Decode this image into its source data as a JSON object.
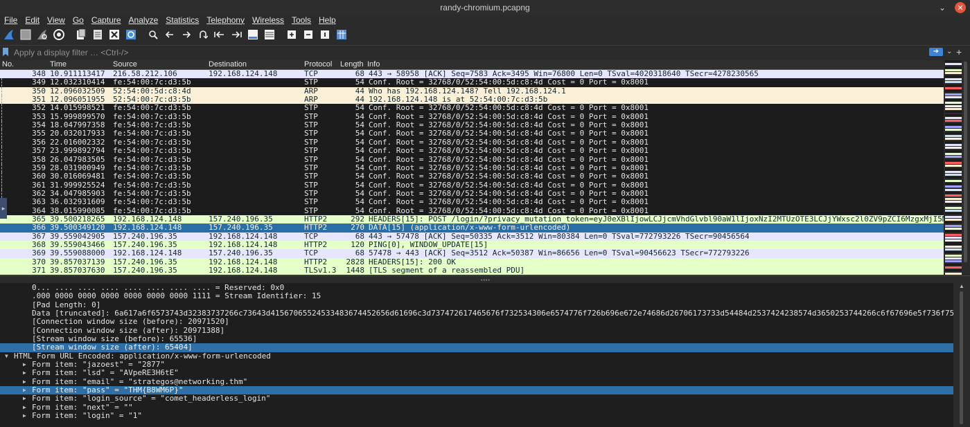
{
  "window": {
    "title": "randy-chromium.pcapng",
    "minimize_glyph": "⌄",
    "close_glyph": "✕"
  },
  "menu": [
    "File",
    "Edit",
    "View",
    "Go",
    "Capture",
    "Analyze",
    "Statistics",
    "Telephony",
    "Wireless",
    "Tools",
    "Help"
  ],
  "filter": {
    "placeholder": "Apply a display filter … <Ctrl-/>",
    "value": ""
  },
  "packet_list": {
    "columns": [
      "No.",
      "Time",
      "Source",
      "Destination",
      "Protocol",
      "Length",
      "Info"
    ],
    "colors": {
      "tcp": "#e7e6ff",
      "arp": "#faf0d7",
      "stp": "#1c1c1c",
      "http": "#e4ffc7",
      "selected": "#2a6ea6"
    },
    "rows": [
      {
        "no": "348",
        "time": "10.911113417",
        "src": "216.58.212.106",
        "dst": "192.168.124.148",
        "proto": "TCP",
        "len": "68",
        "info": "443 → 58958 [ACK] Seq=7583 Ack=3495 Win=76800 Len=0 TSval=4020318640 TSecr=4278230565",
        "style": "tcp"
      },
      {
        "no": "349",
        "time": "12.032310414",
        "src": "fe:54:00:7c:d3:5b",
        "dst": "",
        "proto": "STP",
        "len": "54",
        "info": "Conf. Root = 32768/0/52:54:00:5d:c8:4d  Cost = 0  Port = 0x8001",
        "style": "stp"
      },
      {
        "no": "350",
        "time": "12.096032509",
        "src": "52:54:00:5d:c8:4d",
        "dst": "",
        "proto": "ARP",
        "len": "44",
        "info": "Who has 192.168.124.148? Tell 192.168.124.1",
        "style": "arp"
      },
      {
        "no": "351",
        "time": "12.096051955",
        "src": "52:54:00:7c:d3:5b",
        "dst": "",
        "proto": "ARP",
        "len": "44",
        "info": "192.168.124.148 is at 52:54:00:7c:d3:5b",
        "style": "arp"
      },
      {
        "no": "352",
        "time": "14.015998521",
        "src": "fe:54:00:7c:d3:5b",
        "dst": "",
        "proto": "STP",
        "len": "54",
        "info": "Conf. Root = 32768/0/52:54:00:5d:c8:4d  Cost = 0  Port = 0x8001",
        "style": "stp"
      },
      {
        "no": "353",
        "time": "15.999899570",
        "src": "fe:54:00:7c:d3:5b",
        "dst": "",
        "proto": "STP",
        "len": "54",
        "info": "Conf. Root = 32768/0/52:54:00:5d:c8:4d  Cost = 0  Port = 0x8001",
        "style": "stp"
      },
      {
        "no": "354",
        "time": "18.047997358",
        "src": "fe:54:00:7c:d3:5b",
        "dst": "",
        "proto": "STP",
        "len": "54",
        "info": "Conf. Root = 32768/0/52:54:00:5d:c8:4d  Cost = 0  Port = 0x8001",
        "style": "stp"
      },
      {
        "no": "355",
        "time": "20.032017933",
        "src": "fe:54:00:7c:d3:5b",
        "dst": "",
        "proto": "STP",
        "len": "54",
        "info": "Conf. Root = 32768/0/52:54:00:5d:c8:4d  Cost = 0  Port = 0x8001",
        "style": "stp"
      },
      {
        "no": "356",
        "time": "22.016002332",
        "src": "fe:54:00:7c:d3:5b",
        "dst": "",
        "proto": "STP",
        "len": "54",
        "info": "Conf. Root = 32768/0/52:54:00:5d:c8:4d  Cost = 0  Port = 0x8001",
        "style": "stp"
      },
      {
        "no": "357",
        "time": "23.999892794",
        "src": "fe:54:00:7c:d3:5b",
        "dst": "",
        "proto": "STP",
        "len": "54",
        "info": "Conf. Root = 32768/0/52:54:00:5d:c8:4d  Cost = 0  Port = 0x8001",
        "style": "stp"
      },
      {
        "no": "358",
        "time": "26.047983505",
        "src": "fe:54:00:7c:d3:5b",
        "dst": "",
        "proto": "STP",
        "len": "54",
        "info": "Conf. Root = 32768/0/52:54:00:5d:c8:4d  Cost = 0  Port = 0x8001",
        "style": "stp"
      },
      {
        "no": "359",
        "time": "28.031900949",
        "src": "fe:54:00:7c:d3:5b",
        "dst": "",
        "proto": "STP",
        "len": "54",
        "info": "Conf. Root = 32768/0/52:54:00:5d:c8:4d  Cost = 0  Port = 0x8001",
        "style": "stp"
      },
      {
        "no": "360",
        "time": "30.016069481",
        "src": "fe:54:00:7c:d3:5b",
        "dst": "",
        "proto": "STP",
        "len": "54",
        "info": "Conf. Root = 32768/0/52:54:00:5d:c8:4d  Cost = 0  Port = 0x8001",
        "style": "stp"
      },
      {
        "no": "361",
        "time": "31.999925524",
        "src": "fe:54:00:7c:d3:5b",
        "dst": "",
        "proto": "STP",
        "len": "54",
        "info": "Conf. Root = 32768/0/52:54:00:5d:c8:4d  Cost = 0  Port = 0x8001",
        "style": "stp"
      },
      {
        "no": "362",
        "time": "34.047985903",
        "src": "fe:54:00:7c:d3:5b",
        "dst": "",
        "proto": "STP",
        "len": "54",
        "info": "Conf. Root = 32768/0/52:54:00:5d:c8:4d  Cost = 0  Port = 0x8001",
        "style": "stp"
      },
      {
        "no": "363",
        "time": "36.032931609",
        "src": "fe:54:00:7c:d3:5b",
        "dst": "",
        "proto": "STP",
        "len": "54",
        "info": "Conf. Root = 32768/0/52:54:00:5d:c8:4d  Cost = 0  Port = 0x8001",
        "style": "stp"
      },
      {
        "no": "364",
        "time": "38.015990085",
        "src": "fe:54:00:7c:d3:5b",
        "dst": "",
        "proto": "STP",
        "len": "54",
        "info": "Conf. Root = 32768/0/52:54:00:5d:c8:4d  Cost = 0  Port = 0x8001",
        "style": "stp"
      },
      {
        "no": "365",
        "time": "39.500218265",
        "src": "192.168.124.148",
        "dst": "157.240.196.35",
        "proto": "HTTP2",
        "len": "292",
        "info": "HEADERS[15]: POST /login/?privacy_mutation_token=eyJ0eXBlIjowLCJjcmVhdGlvbl90aW1lIjoxNzI2MTUzOTE3LCJjYWxsc2l0ZV9pZCI6MzgxMjI5MD",
        "style": "http"
      },
      {
        "no": "366",
        "time": "39.500349120",
        "src": "192.168.124.148",
        "dst": "157.240.196.35",
        "proto": "HTTP2",
        "len": "270",
        "info": "DATA[15] (application/x-www-form-urlencoded)",
        "style": "selected"
      },
      {
        "no": "367",
        "time": "39.559042905",
        "src": "157.240.196.35",
        "dst": "192.168.124.148",
        "proto": "TCP",
        "len": "68",
        "info": "443 → 57478 [ACK] Seq=50335 Ack=3512 Win=80384 Len=0 TSval=772793226 TSecr=90456564",
        "style": "tcp"
      },
      {
        "no": "368",
        "time": "39.559043466",
        "src": "157.240.196.35",
        "dst": "192.168.124.148",
        "proto": "HTTP2",
        "len": "120",
        "info": "PING[0], WINDOW_UPDATE[15]",
        "style": "http"
      },
      {
        "no": "369",
        "time": "39.559088000",
        "src": "192.168.124.148",
        "dst": "157.240.196.35",
        "proto": "TCP",
        "len": "68",
        "info": "57478 → 443 [ACK] Seq=3512 Ack=50387 Win=86656 Len=0 TSval=90456623 TSecr=772793226",
        "style": "tcp"
      },
      {
        "no": "370",
        "time": "39.857037139",
        "src": "157.240.196.35",
        "dst": "192.168.124.148",
        "proto": "HTTP2",
        "len": "2828",
        "info": "HEADERS[15]: 200 OK",
        "style": "http"
      },
      {
        "no": "371",
        "time": "39.857037630",
        "src": "157.240.196.35",
        "dst": "192.168.124.148",
        "proto": "TLSv1.3",
        "len": "1448",
        "info": "[TLS segment of a reassembled PDU]",
        "style": "http"
      }
    ]
  },
  "details": {
    "lines": [
      {
        "text": "0... .... .... .... .... .... .... .... = Reserved: 0x0",
        "indent": 3,
        "arrow": "",
        "selected": false
      },
      {
        "text": ".000 0000 0000 0000 0000 0000 0000 1111 = Stream Identifier: 15",
        "indent": 3,
        "arrow": "",
        "selected": false
      },
      {
        "text": "[Pad Length: 0]",
        "indent": 3,
        "arrow": "",
        "selected": false
      },
      {
        "text": "Data [truncated]: 6a617a6f6573743d32383737266c73643d41567065524533483674452656d61696c3d737472617465676f732534306e6574776f726b696e672e74686d26706173733d54484d2537424238574d3650253744266c6f67696e5f736f757",
        "indent": 3,
        "arrow": "",
        "selected": false
      },
      {
        "text": "[Connection window size (before): 20971520]",
        "indent": 3,
        "arrow": "",
        "selected": false
      },
      {
        "text": "[Connection window size (after): 20971388]",
        "indent": 3,
        "arrow": "",
        "selected": false
      },
      {
        "text": "[Stream window size (before): 65536]",
        "indent": 3,
        "arrow": "",
        "selected": false
      },
      {
        "text": "[Stream window size (after): 65404]",
        "indent": 3,
        "arrow": "",
        "selected": true
      },
      {
        "text": "HTML Form URL Encoded: application/x-www-form-urlencoded",
        "indent": 1,
        "arrow": "▼",
        "selected": false
      },
      {
        "text": "Form item: \"jazoest\" = \"2877\"",
        "indent": 3,
        "arrow": "▶",
        "selected": false
      },
      {
        "text": "Form item: \"lsd\" = \"AVpeRE3H6tE\"",
        "indent": 3,
        "arrow": "▶",
        "selected": false
      },
      {
        "text": "Form item: \"email\" = \"strategos@networking.thm\"",
        "indent": 3,
        "arrow": "▶",
        "selected": false
      },
      {
        "text": "Form item: \"pass\" = \"THM{B8WM6P}\"",
        "indent": 3,
        "arrow": "▶",
        "selected": true
      },
      {
        "text": "Form item: \"login_source\" = \"comet_headerless_login\"",
        "indent": 3,
        "arrow": "▶",
        "selected": false
      },
      {
        "text": "Form item: \"next\" = \"\"",
        "indent": 3,
        "arrow": "▶",
        "selected": false
      },
      {
        "text": "Form item: \"login\" = \"1\"",
        "indent": 3,
        "arrow": "▶",
        "selected": false
      }
    ]
  },
  "minimap": {
    "colors": [
      "#e7e6ff",
      "#1c1c1c",
      "#faf0d7",
      "#e4ffc7",
      "#c8e0f8",
      "#ff5f5f",
      "#a0a0ff",
      "#f0f0f0"
    ]
  }
}
